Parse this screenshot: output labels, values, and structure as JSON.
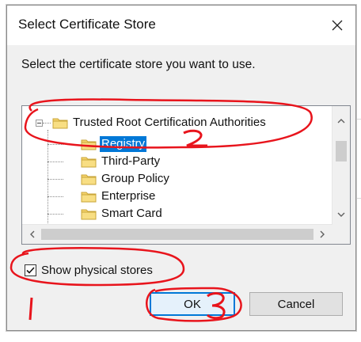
{
  "dialog": {
    "title": "Select Certificate Store",
    "prompt": "Select the certificate store you want to use."
  },
  "tree": {
    "root": {
      "label": "Trusted Root Certification Authorities",
      "icon": "folder-icon",
      "expander": "minus"
    },
    "children": [
      {
        "label": "Registry",
        "selected": true,
        "icon": "folder-icon"
      },
      {
        "label": "Third-Party",
        "selected": false,
        "icon": "folder-icon"
      },
      {
        "label": "Group Policy",
        "selected": false,
        "icon": "folder-icon"
      },
      {
        "label": "Enterprise",
        "selected": false,
        "icon": "folder-icon"
      },
      {
        "label": "Smart Card",
        "selected": false,
        "icon": "folder-icon"
      }
    ]
  },
  "options": {
    "show_physical_label": "Show physical stores",
    "show_physical_checked": true
  },
  "buttons": {
    "ok": "OK",
    "cancel": "Cancel"
  },
  "annotations": {
    "color": "#e8141c",
    "marks": [
      "1",
      "2",
      "3"
    ]
  },
  "colors": {
    "selection": "#0078d7",
    "folder": "#f5d36b"
  }
}
